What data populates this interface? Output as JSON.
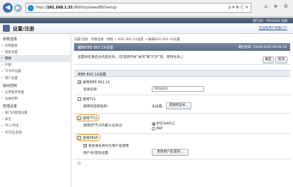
{
  "browser": {
    "url_prefix": "http://",
    "url_host": "192.168.1.31",
    "url_path": ":8000/rps/ieeeBSDsetcgi",
    "url_tools": "ρ ▾ ⊗ C ✕",
    "back_glyph": "◀",
    "forward_glyph": "▶",
    "toolbar_icons": "⌂ ★ ⚙"
  },
  "app": {
    "topbar_text": "部门ID：7654321  注销",
    "portal_title": "设置/注册",
    "portal_link": "至远程用户界面门户"
  },
  "sidebar": {
    "groups": [
      {
        "title": "参数选择",
        "items": [
          {
            "label": "控制面板",
            "active": false
          },
          {
            "label": "纸张设置",
            "active": false
          },
          {
            "label": "网络",
            "active": true
          },
          {
            "label": "外部",
            "active": false
          },
          {
            "label": "TCP/IP设置",
            "active": false
          },
          {
            "label": "用户设置",
            "active": false
          }
        ]
      },
      {
        "title": "输出控制",
        "items": [
          {
            "label": "应用程序界面",
            "active": false
          },
          {
            "label": "设备控制",
            "active": false
          }
        ]
      },
      {
        "title": "管理设置",
        "items": [
          {
            "label": "部门ID管理设置",
            "active": false
          },
          {
            "label": "安全",
            "active": false
          },
          {
            "label": "导入/导出",
            "active": false
          },
          {
            "label": "许可证/其他",
            "active": false
          }
        ]
      }
    ]
  },
  "main": {
    "breadcrumb": "设置/注册 : 参数选择 : 网络 > IEEE 802.1X设置 > 编辑IEEE 802.1X设置",
    "panel_title": "编辑IEEE 802.1X设置",
    "timestamp": "最后更新: 25/09 2015 03:04:16",
    "notice": "设置将在重启主机后生效。(在电源开关\"关闭\"再\"打开\"后，更改生效。)",
    "ok_label": "确定",
    "cancel_label": "取消",
    "section_title": "IEEE 802.1X设置",
    "use_ieee": "使用IEEE 802.1X",
    "login_name_label": "登录名称:",
    "login_name_value": "7654321",
    "use_tls": "使用TLS",
    "tls_key_label": "使用的密钥名称:",
    "tls_key_value": "未设置。",
    "key_cert_button": "密钥和证书...",
    "use_ttls": "使用TTLS",
    "ttls_protocol_label": "使用的TTLS内部认证协议:",
    "protocol_options": [
      "MSCHAPv2",
      "PAP"
    ],
    "use_peap": "使用PEAP",
    "same_login": "将登录名称作为用户名使用",
    "user_pw_label": "用户名/密码设置:",
    "change_user_pw_button": "更改用户名/密码...",
    "bottom_glyph": "⊡"
  },
  "colors": {
    "highlight": "#e8951c",
    "panel_title_bg": "#5c6d86",
    "link": "#2b5aa8"
  }
}
